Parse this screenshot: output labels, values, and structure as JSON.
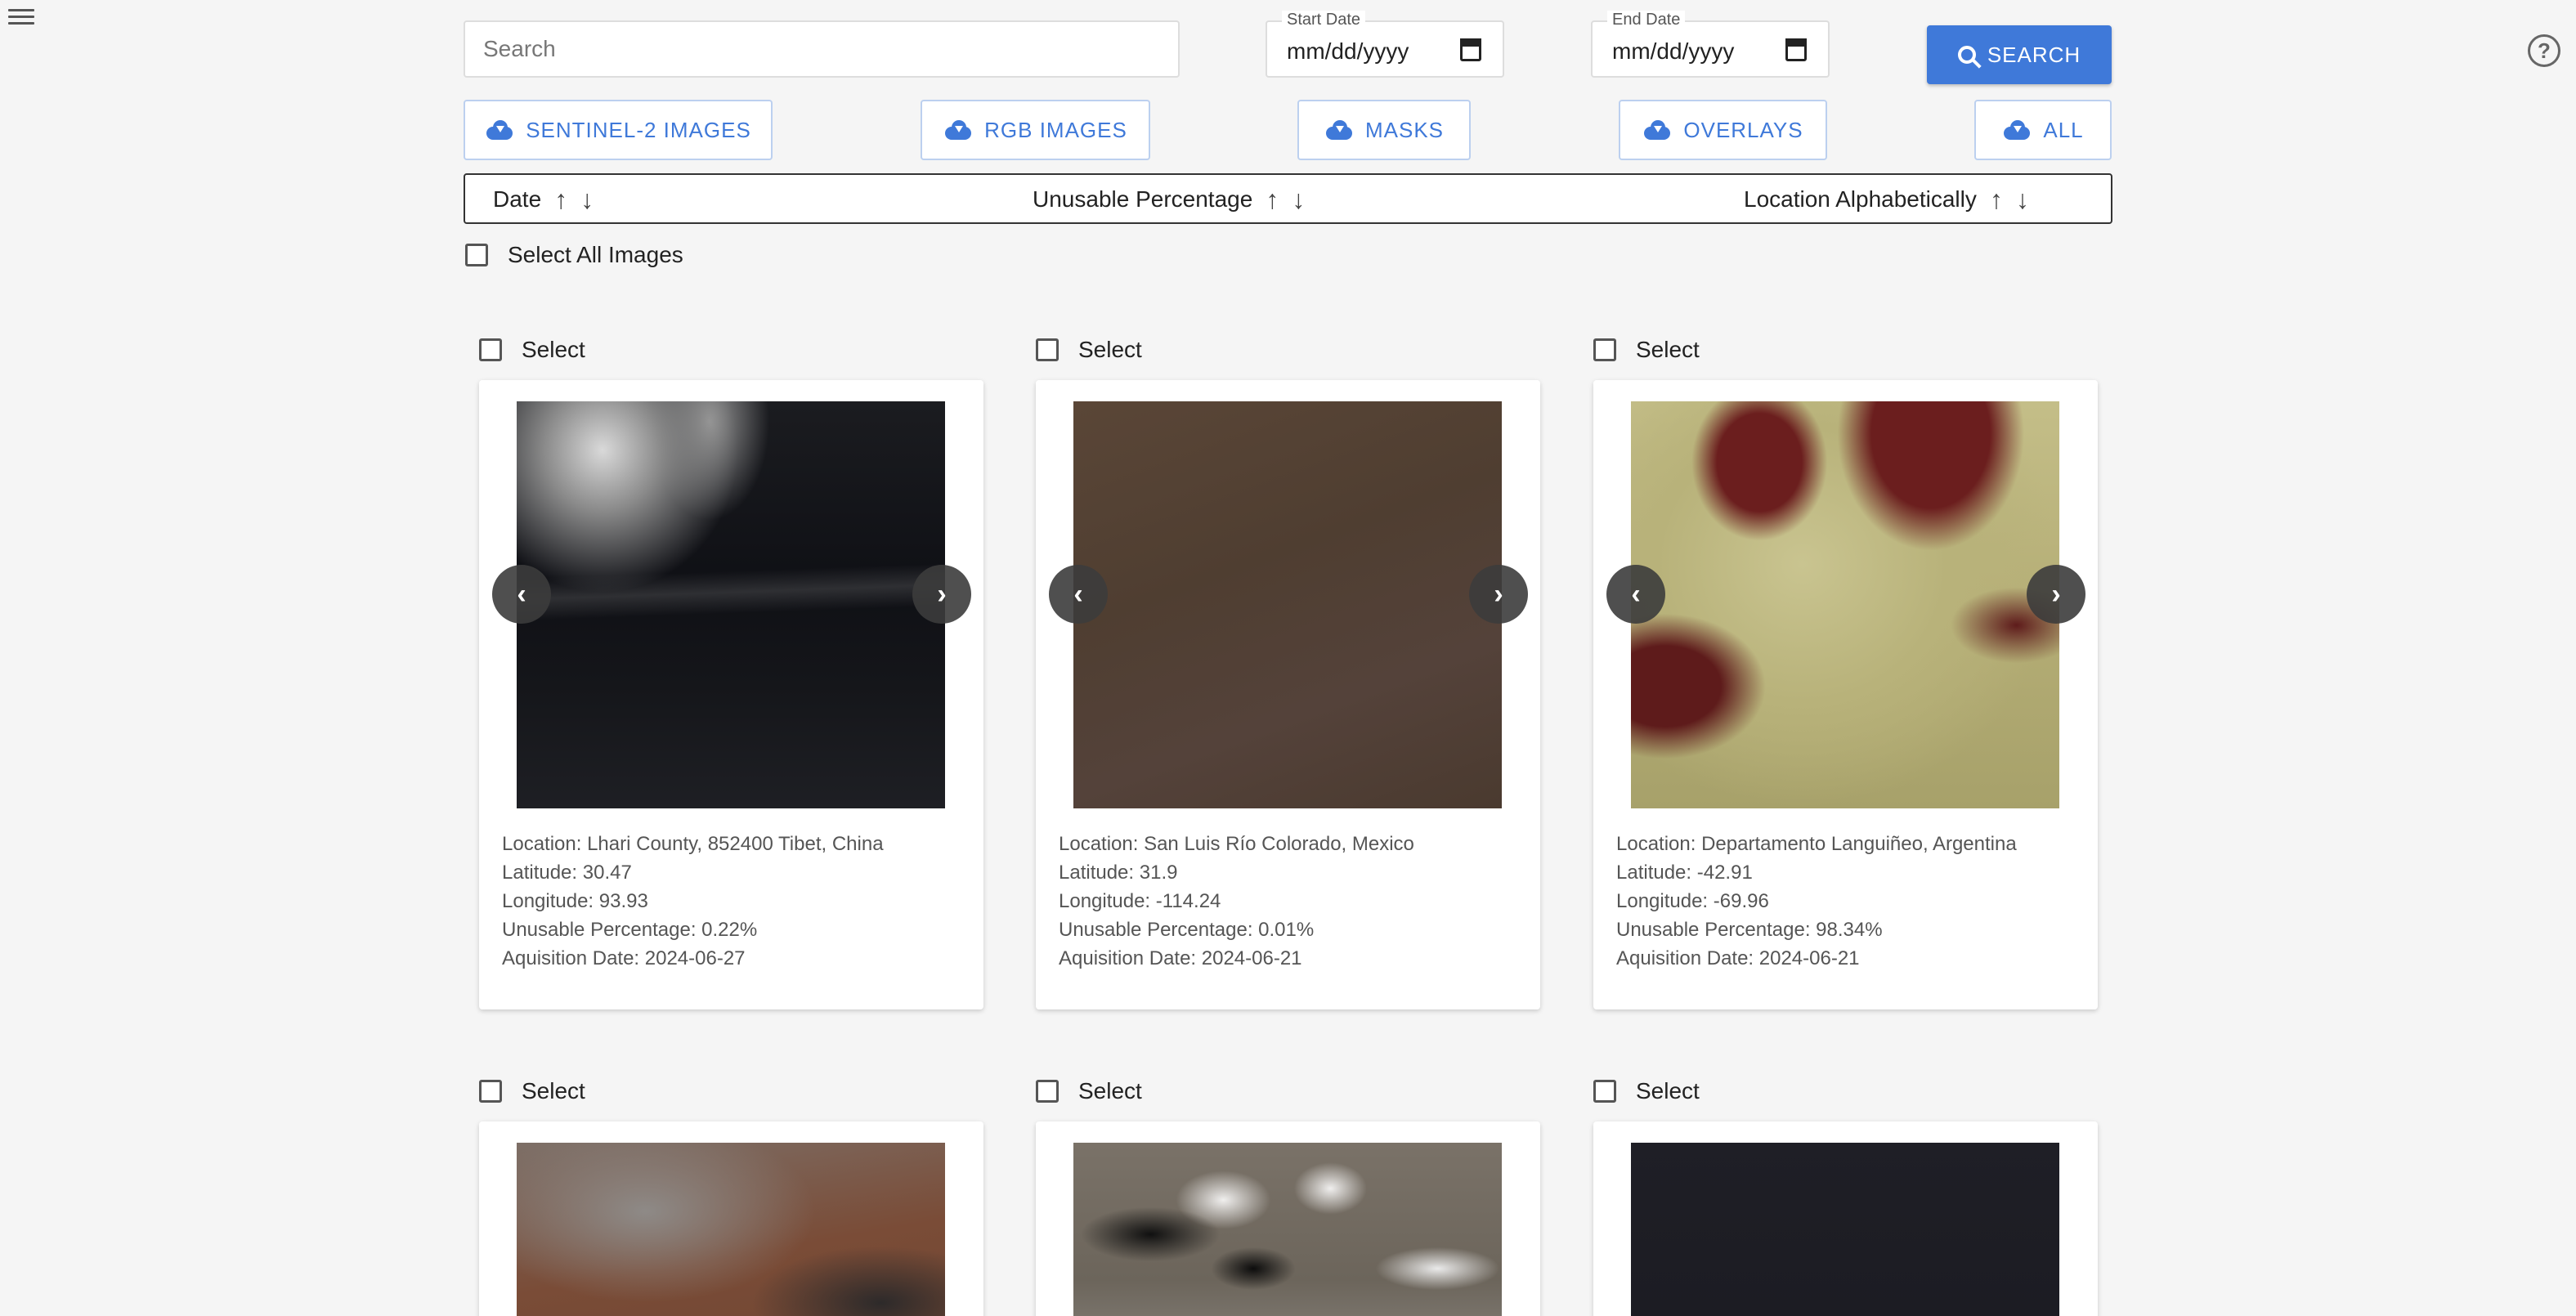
{
  "search": {
    "placeholder": "Search"
  },
  "start_date": {
    "label": "Start Date",
    "value": "mm/dd/yyyy"
  },
  "end_date": {
    "label": "End Date",
    "value": "mm/dd/yyyy"
  },
  "search_button": "SEARCH",
  "downloads": {
    "sentinel": "SENTINEL-2 IMAGES",
    "rgb": "RGB IMAGES",
    "masks": "MASKS",
    "overlays": "OVERLAYS",
    "all": "ALL"
  },
  "sort": {
    "date": "Date",
    "unusable": "Unusable Percentage",
    "location": "Location Alphabetically"
  },
  "select_all": "Select All Images",
  "select_label": "Select",
  "cards": [
    {
      "location": "Location: Lhari County, 852400 Tibet, China",
      "latitude": "Latitude: 30.47",
      "longitude": "Longitude: 93.93",
      "unusable": "Unusable Percentage: 0.22%",
      "date": "Aquisition Date: 2024-06-27"
    },
    {
      "location": "Location: San Luis Río Colorado, Mexico",
      "latitude": "Latitude: 31.9",
      "longitude": "Longitude: -114.24",
      "unusable": "Unusable Percentage: 0.01%",
      "date": "Aquisition Date: 2024-06-21"
    },
    {
      "location": "Location: Departamento Languiñeo, Argentina",
      "latitude": "Latitude: -42.91",
      "longitude": "Longitude: -69.96",
      "unusable": "Unusable Percentage: 98.34%",
      "date": "Aquisition Date: 2024-06-21"
    }
  ],
  "icons": {
    "menu": "menu-icon",
    "help": "help-circle-icon",
    "search": "search-icon",
    "download": "cloud-download-icon",
    "sort_up": "arrow-up-icon",
    "sort_down": "arrow-down-icon",
    "prev": "chevron-left-icon",
    "next": "chevron-right-icon"
  },
  "colors": {
    "accent": "#3f79d9",
    "background": "#f5f5f5"
  }
}
